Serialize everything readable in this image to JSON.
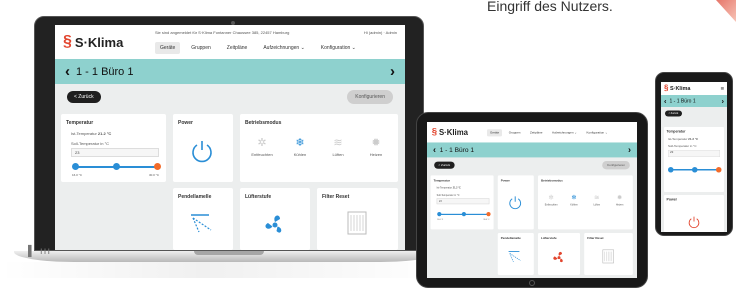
{
  "caption": "Eingriff des Nutzers.",
  "app": {
    "brand": "S·Klima",
    "header_info": "Sie sind angemeldet für S·Klima Fontanner Chaussee 385, 22457 Hamburg",
    "header_user": "Hi (admin) · Admin",
    "nav": [
      "Geräte",
      "Gruppen",
      "Zeitpläne",
      "Aufzeichnungen ⌄",
      "Konfiguration ⌄"
    ],
    "title": "1 - 1 Büro 1",
    "back_label": "< Zurück",
    "config_label": "Konfigurieren",
    "temperature": {
      "title": "Temperatur",
      "current_label": "Ist-Temperatur",
      "current_value": "21.2 °C",
      "setpoint_label": "Soll-Temperatur in °C",
      "setpoint_value": "23",
      "range_min": "16.0 °C",
      "range_max": "30.0 °C"
    },
    "power": {
      "title": "Power"
    },
    "modes": {
      "title": "Betriebsmodus",
      "items": [
        "Entfeuchten",
        "Kühlen",
        "Lüften",
        "Heizen"
      ]
    },
    "vane": {
      "title": "Pendellamelle"
    },
    "fan": {
      "title": "Lüfterstufe"
    },
    "filter": {
      "title": "Filter Reset"
    }
  },
  "phone_app": {
    "title": "1 - 1 Büro 1",
    "back_label": "< Zurück",
    "temperature_title": "Temperatur",
    "power_title": "Power"
  },
  "colors": {
    "accent_teal": "#8ed1ce",
    "brand_red": "#e2452e",
    "slider_blue": "#2a8ed6",
    "knob_orange": "#f26b2a"
  }
}
